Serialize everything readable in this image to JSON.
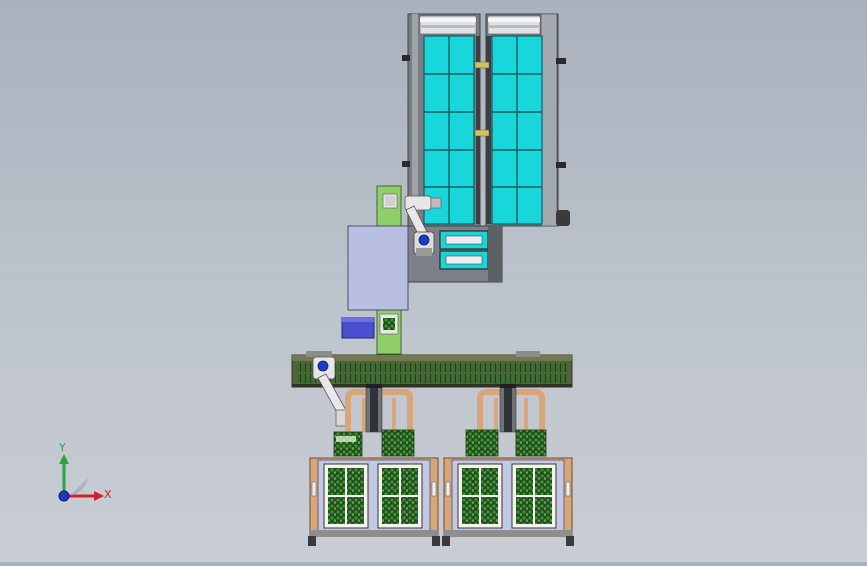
{
  "viewport": {
    "colors": {
      "background_top": "#a9b1bd",
      "background_bottom": "#c9cdd4",
      "frame_gray": "#6f7379",
      "frame_dark": "#4c5055",
      "tray_cyan": "#19d6da",
      "conveyor_green": "#3e6b30",
      "guide_green": "#8fcf6a",
      "wood_tan": "#d8a679",
      "plant_green": "#2f6d2a",
      "robot_white": "#e6e6e6",
      "accent_blue": "#1b3cc8",
      "panel_lavender": "#b9bfe1",
      "indigo_block": "#4a4fd0",
      "label_paper": "#f4f4ef"
    },
    "icons": [
      "robot-arm-icon",
      "conveyor-icon",
      "coordinate-triad-icon"
    ]
  },
  "triad": {
    "x_label": "X",
    "y_label": "Y",
    "x_color": "#d4202a",
    "y_color": "#2aa63a",
    "z_color": "#2036c8"
  }
}
